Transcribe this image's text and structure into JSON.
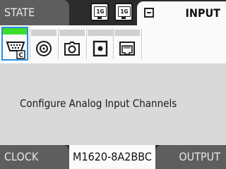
{
  "header": {
    "state_label": "STATE",
    "input_label": "INPUT",
    "net_icons": [
      {
        "label": "1G",
        "icon": "ethernet-1g-icon"
      },
      {
        "label": "1G",
        "icon": "ethernet-1g-icon"
      }
    ]
  },
  "channels": [
    {
      "icon": "analog-input-icon",
      "badge": "C",
      "active": true,
      "status_color": "#3cdc2c"
    },
    {
      "icon": "bnc-connector-icon",
      "active": false
    },
    {
      "icon": "camera-connector-icon",
      "active": false
    },
    {
      "icon": "dot-connector-icon",
      "active": false
    },
    {
      "icon": "rj45-port-icon",
      "active": false
    }
  ],
  "main": {
    "message": "Configure Analog Input Channels"
  },
  "footer": {
    "clock_label": "CLOCK",
    "device_id": "M1620-8A2BBC",
    "output_label": "OUTPUT"
  },
  "colors": {
    "active_border": "#2a8ce0",
    "active_status": "#3cdc2c",
    "bar_dark": "#2c2c2c",
    "tab_gray": "#5e5e5e"
  }
}
